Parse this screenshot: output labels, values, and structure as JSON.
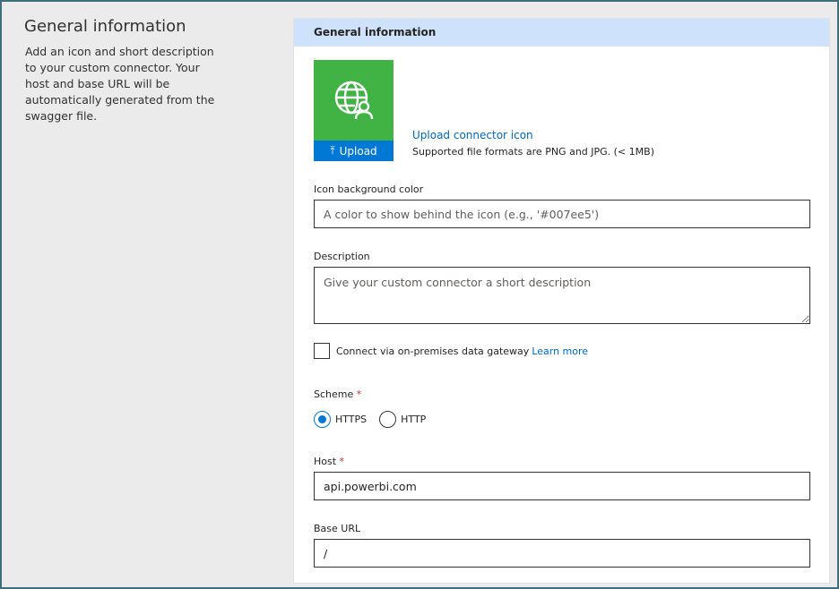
{
  "left_pane": {
    "title": "General information",
    "description": "Add an icon and short description to your custom connector. Your host and base URL will be automatically generated from the swagger file."
  },
  "panel": {
    "header": "General information",
    "icon": {
      "name": "globe-person-icon",
      "tile_color": "#41b344",
      "upload_label": "Upload",
      "upload_link": "Upload connector icon",
      "formats_note": "Supported file formats are PNG and JPG. (< 1MB)"
    },
    "icon_bg": {
      "label": "Icon background color",
      "placeholder": "A color to show behind the icon (e.g., '#007ee5')",
      "value": ""
    },
    "description": {
      "label": "Description",
      "placeholder": "Give your custom connector a short description",
      "value": ""
    },
    "gateway": {
      "label": "Connect via on-premises data gateway",
      "link": "Learn more",
      "checked": false
    },
    "scheme": {
      "label": "Scheme",
      "required_mark": "*",
      "options": [
        "HTTPS",
        "HTTP"
      ],
      "selected": "HTTPS"
    },
    "host": {
      "label": "Host",
      "required_mark": "*",
      "value": "api.powerbi.com"
    },
    "base_url": {
      "label": "Base URL",
      "value": "/"
    }
  },
  "colors": {
    "accent": "#0078d4",
    "header_bg": "#cfe2fb",
    "frame": "#3f6f7c"
  }
}
